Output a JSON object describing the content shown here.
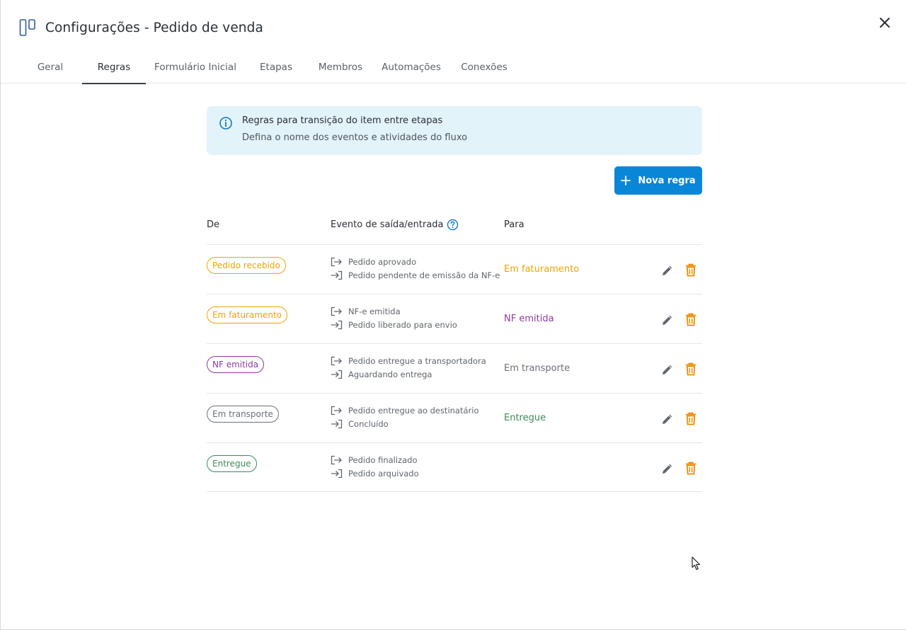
{
  "window": {
    "title": "Configurações - Pedido de venda"
  },
  "tabs": [
    {
      "label": "Geral",
      "active": false
    },
    {
      "label": "Regras",
      "active": true
    },
    {
      "label": "Formulário Inicial",
      "active": false
    },
    {
      "label": "Etapas",
      "active": false
    },
    {
      "label": "Membros",
      "active": false
    },
    {
      "label": "Automações",
      "active": false
    },
    {
      "label": "Conexões",
      "active": false
    }
  ],
  "banner": {
    "title": "Regras para transição do item entre etapas",
    "subtitle": "Defina o nome dos eventos e atividades do fluxo"
  },
  "toolbar": {
    "new_rule_label": "Nova regra"
  },
  "table": {
    "headers": {
      "from": "De",
      "event": "Evento de saída/entrada",
      "to": "Para"
    },
    "rows": [
      {
        "from": "Pedido recebido",
        "exit_event": "Pedido aprovado",
        "entry_event": "Pedido pendente de emissão da NF-e",
        "to": "Em faturamento"
      },
      {
        "from": "Em faturamento",
        "exit_event": "NF-e emitida",
        "entry_event": "Pedido liberado para envio",
        "to": "NF emitida"
      },
      {
        "from": "NF emitida",
        "exit_event": "Pedido entregue a transportadora",
        "entry_event": "Aguardando entrega",
        "to": "Em transporte"
      },
      {
        "from": "Em transporte",
        "exit_event": "Pedido entregue ao destinatário",
        "entry_event": "Concluído",
        "to": "Entregue"
      },
      {
        "from": "Entregue",
        "exit_event": "Pedido finalizado",
        "entry_event": "Pedido arquivado",
        "to": ""
      }
    ]
  },
  "colors": {
    "primary": "#0a86d8",
    "stage_pedido_recebido": "#f0a400",
    "stage_em_faturamento": "#f0a400",
    "stage_nf_emitida": "#8e3aa0",
    "stage_em_transporte": "#6b7178",
    "stage_entregue": "#3d8a56",
    "delete": "#f08a00"
  },
  "icons": [
    "board-icon",
    "close-icon",
    "info-icon",
    "plus-icon",
    "help-icon",
    "exit-icon",
    "entry-icon",
    "pencil-icon",
    "trash-icon"
  ]
}
